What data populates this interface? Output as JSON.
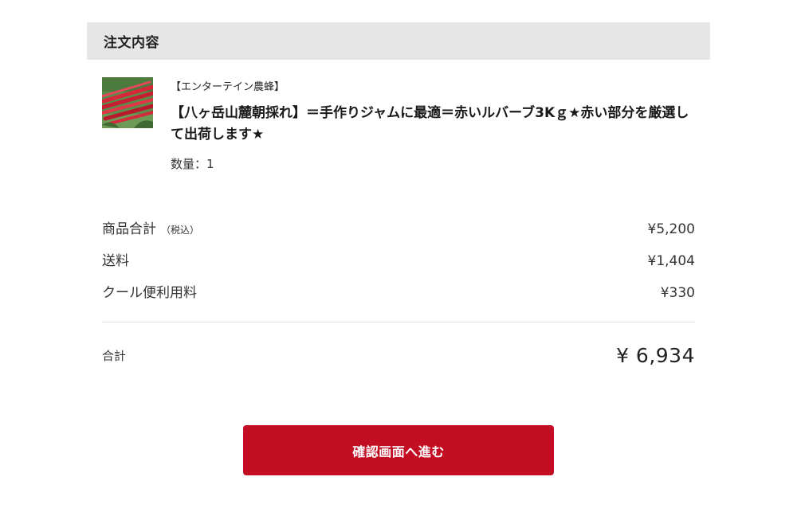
{
  "order": {
    "section_title": "注文内容",
    "item": {
      "image_icon": "rhubarb-product-photo",
      "shop_name": "【エンターテイン農蜂】",
      "title": "【八ヶ岳山麓朝採れ】＝手作りジャムに最適＝赤いルバーブ3Kｇ★赤い部分を厳選して出荷します★",
      "quantity_label": "数量：1"
    }
  },
  "summary": {
    "subtotal_label": "商品合計",
    "subtotal_note": "（税込）",
    "subtotal_value": "¥5,200",
    "shipping_label": "送料",
    "shipping_value": "¥1,404",
    "cool_fee_label": "クール便利用料",
    "cool_fee_value": "¥330",
    "total_label": "合計",
    "total_value": "¥ 6,934"
  },
  "actions": {
    "confirm_label": "確認画面へ進む"
  },
  "colors": {
    "header_bg": "#e6e6e6",
    "button_bg": "#c30d23",
    "button_text": "#ffffff",
    "divider": "#e3e3e3"
  }
}
